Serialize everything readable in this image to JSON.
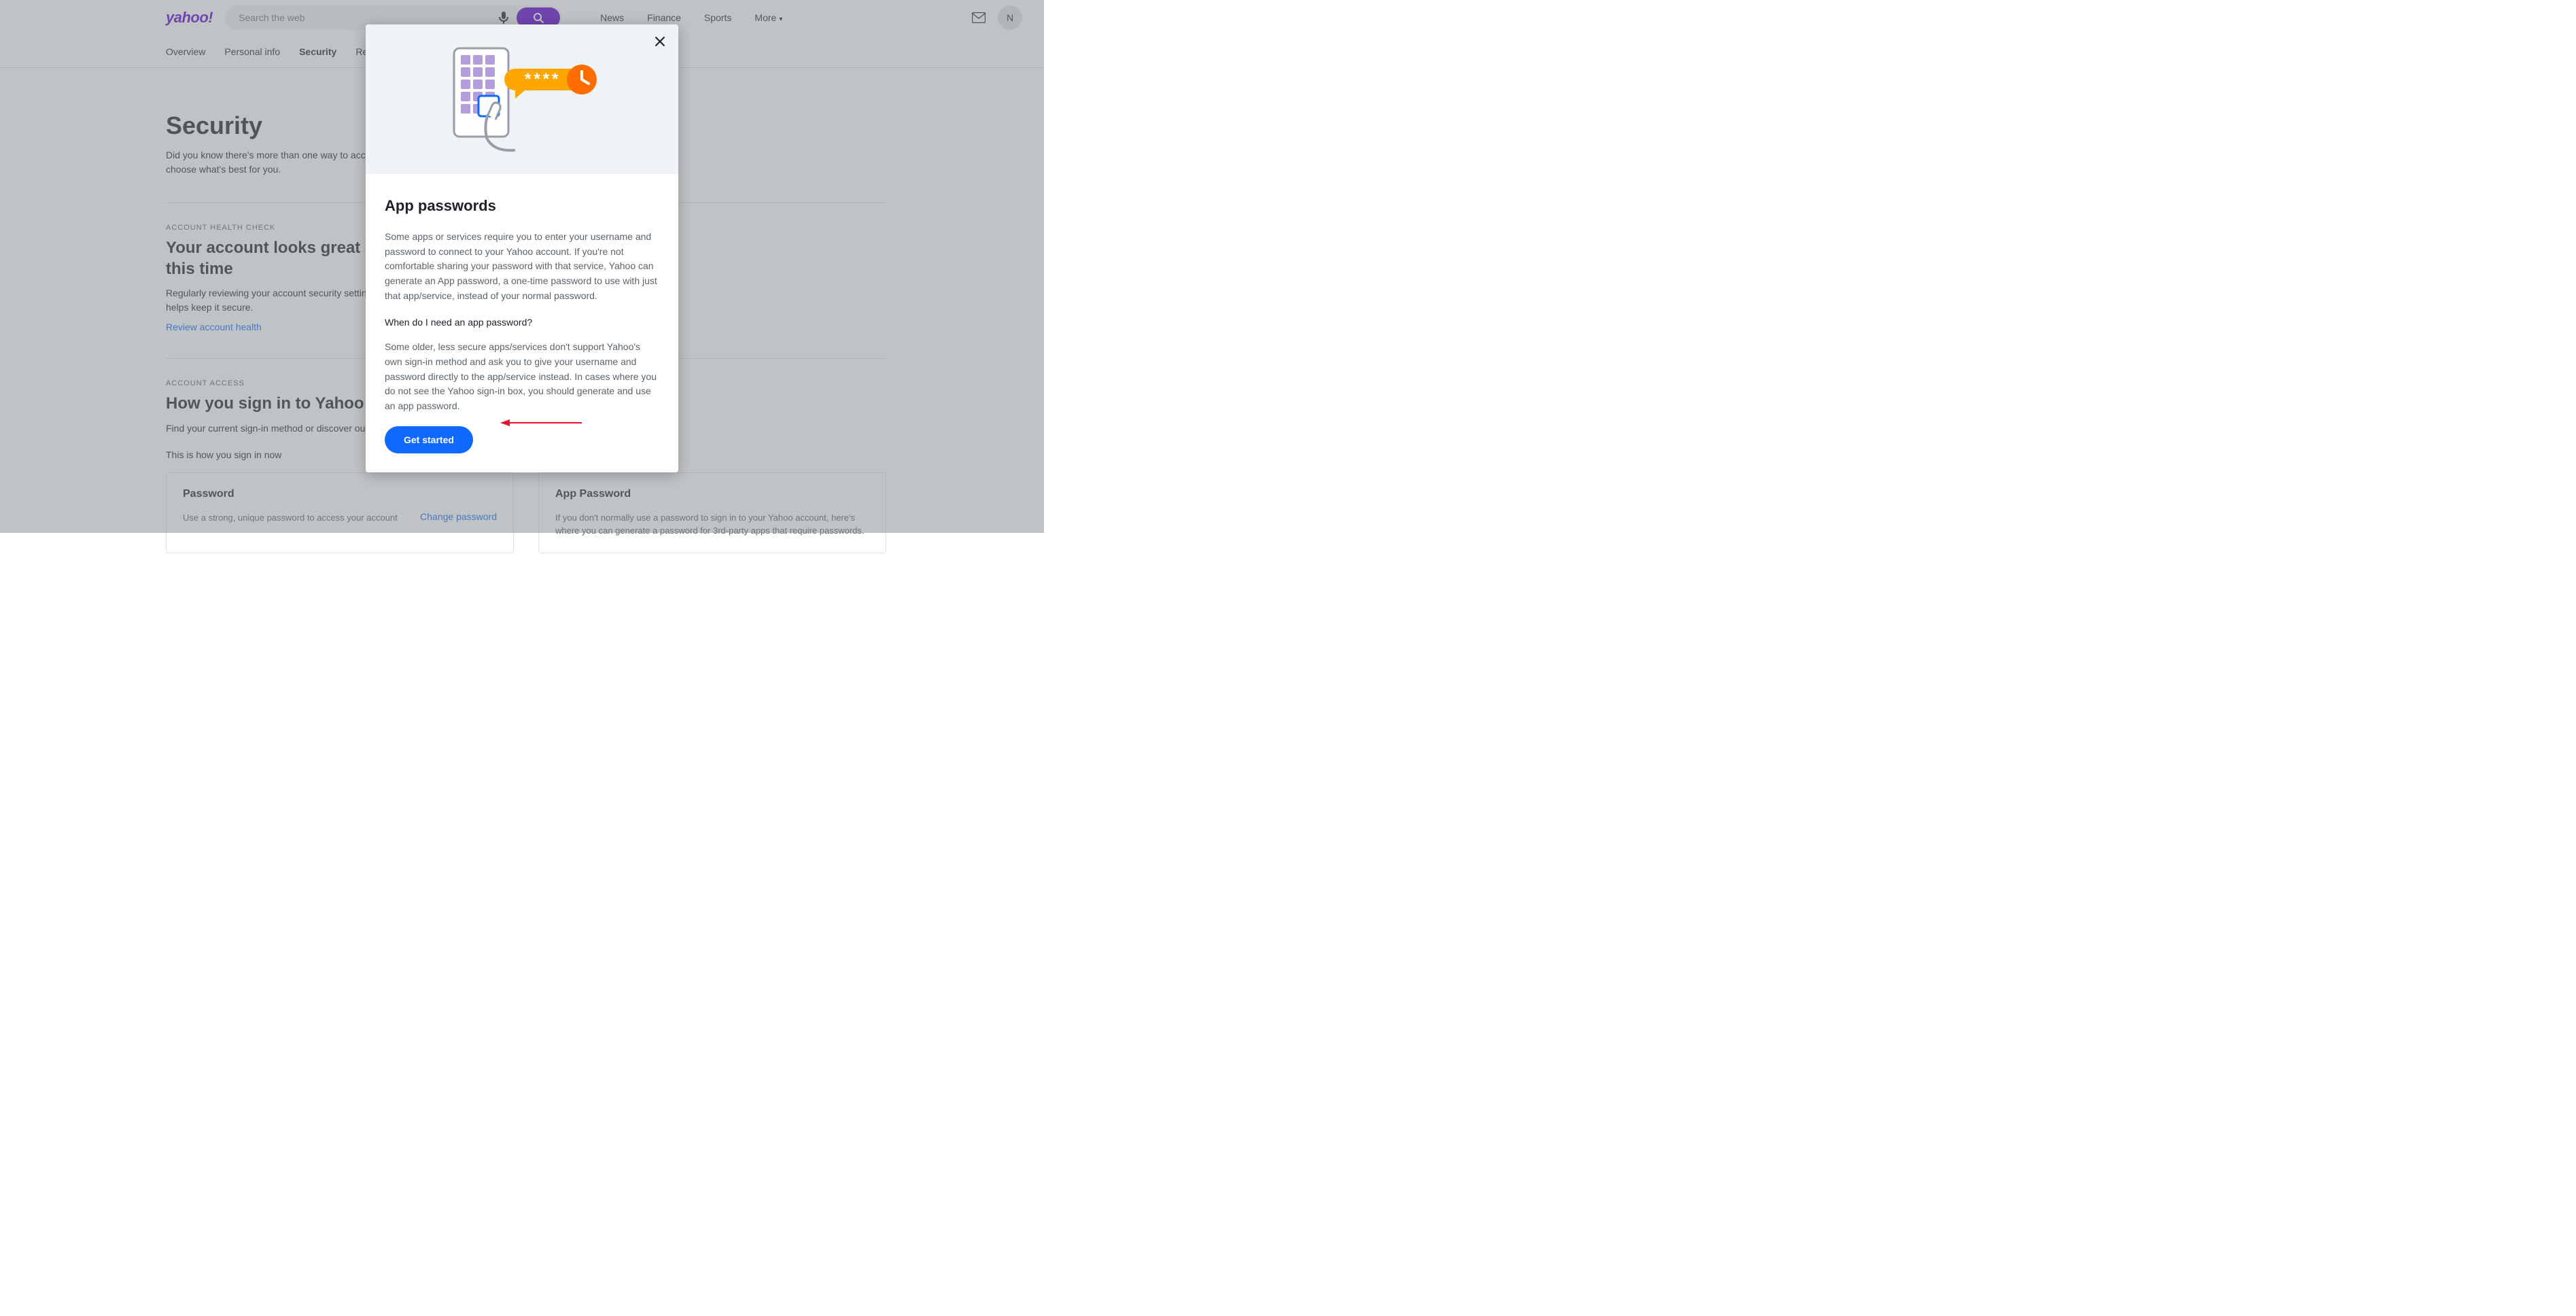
{
  "header": {
    "logo_text": "yahoo!",
    "search_placeholder": "Search the web",
    "nav": [
      "News",
      "Finance",
      "Sports"
    ],
    "more_label": "More",
    "avatar_initial": "N"
  },
  "tabs": {
    "items": [
      "Overview",
      "Personal info",
      "Security",
      "Recent activity"
    ],
    "active_index": 2
  },
  "page": {
    "title": "Security",
    "subtitle": "Did you know there's more than one way to access your Yahoo account? Review your sign-in settings and choose what's best for you.",
    "health": {
      "label": "ACCOUNT HEALTH CHECK",
      "heading": "Your account looks great - no suggestions at this time",
      "body": "Regularly reviewing your account security settings and updating your personal information helps keep it secure.",
      "link": "Review account health"
    },
    "access": {
      "label": "ACCOUNT ACCESS",
      "heading": "How you sign in to Yahoo",
      "body": "Find your current sign-in method or discover our other options.",
      "subhead": "This is how you sign in now",
      "password_card": {
        "title": "Password",
        "desc": "Use a strong, unique password to access your account",
        "action": "Change password"
      },
      "apppw_card": {
        "title": "App Password",
        "desc": "If you don't normally use a password to sign in to your Yahoo account, here's where you can generate a password for 3rd-party apps that require passwords."
      }
    }
  },
  "modal": {
    "title": "App passwords",
    "para1": "Some apps or services require you to enter your username and password to connect to your Yahoo account. If you're not comfortable sharing your password with that service, Yahoo can generate an App password, a one-time password to use with just that app/service, instead of your normal password.",
    "question": "When do I need an app password?",
    "para2": "Some older, less secure apps/services don't support Yahoo's own sign-in method and ask you to give your username and password directly to the app/service instead. In cases where you do not see the Yahoo sign-in box, you should generate and use an app password.",
    "button": "Get started"
  }
}
